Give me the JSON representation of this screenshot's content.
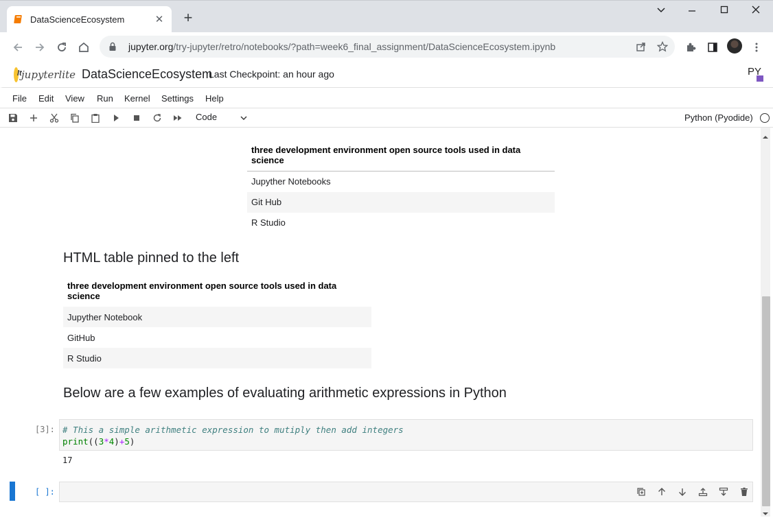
{
  "browser": {
    "tab_title": "DataScienceEcosystem",
    "url_host": "jupyter.org",
    "url_path": "/try-jupyter/retro/notebooks/?path=week6_final_assignment/DataScienceEcosystem.ipynb"
  },
  "jupyter": {
    "logo_text": "jupyterlite",
    "notebook_title": "DataScienceEcosystem",
    "checkpoint": "Last Checkpoint: an hour ago",
    "menu": [
      "File",
      "Edit",
      "View",
      "Run",
      "Kernel",
      "Settings",
      "Help"
    ],
    "cell_type": "Code",
    "kernel_name": "Python (Pyodide)"
  },
  "notebook": {
    "table1": {
      "header": "three development environment open source tools used in data science",
      "rows": [
        "Jupyther Notebooks",
        "Git Hub",
        "R Studio"
      ]
    },
    "heading_left_table": "HTML table pinned to the left",
    "table2": {
      "header": "three development environment open source tools used in data science",
      "rows": [
        "Jupyther Notebook",
        "GitHub",
        "R Studio"
      ]
    },
    "heading_arith": "Below are a few examples of evaluating arithmetic expressions in Python",
    "code_cell": {
      "prompt": "[3]:",
      "comment": "#  This a simple arithmetic expression to mutiply then add integers",
      "code_print": "print",
      "code_open": "((",
      "code_a": "3",
      "code_mul": "*",
      "code_b": "4",
      "code_mid": ")",
      "code_plus": "+",
      "code_c": "5",
      "code_close": ")",
      "output": "17"
    },
    "empty_cell_prompt": "[ ]:"
  },
  "colors": {
    "accent": "#1976d2",
    "chrome_bg": "#dee1e6",
    "cell_bg": "#f5f5f5"
  }
}
